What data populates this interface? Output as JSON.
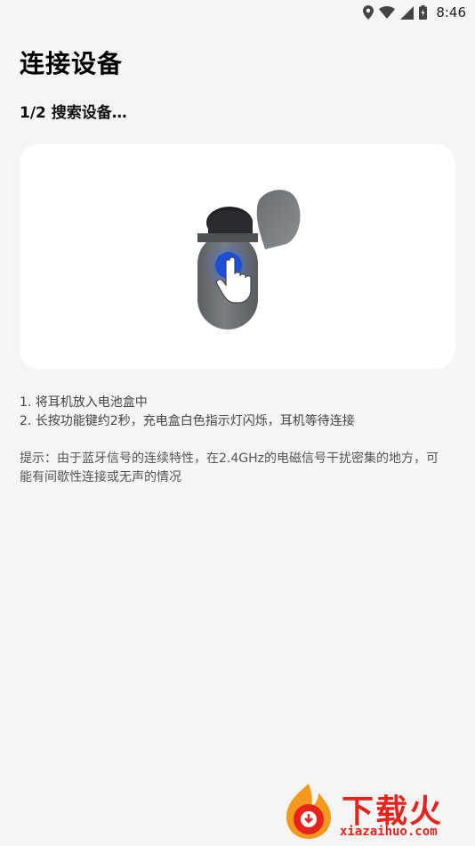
{
  "status_bar": {
    "time": "8:46",
    "icons": [
      "location-icon",
      "wifi-icon",
      "signal-icon",
      "battery-charging-icon"
    ]
  },
  "page": {
    "title": "连接设备",
    "step": "1/2 搜索设备…"
  },
  "illustration": {
    "icon": "earbud-case-press-icon",
    "accent_color": "#1a4fd8"
  },
  "instructions": {
    "items": [
      "1.  将耳机放入电池盒中",
      "2. 长按功能键约2秒，充电盒白色指示灯闪烁，耳机等待连接"
    ],
    "tip": "提示：由于蓝牙信号的连续特性，在2.4GHz的电磁信号干扰密集的地方，可能有间歇性连接或无声的情况"
  },
  "watermark": {
    "text": "下载火",
    "url": "xiazaihuo.com",
    "color": "#e8231c"
  }
}
